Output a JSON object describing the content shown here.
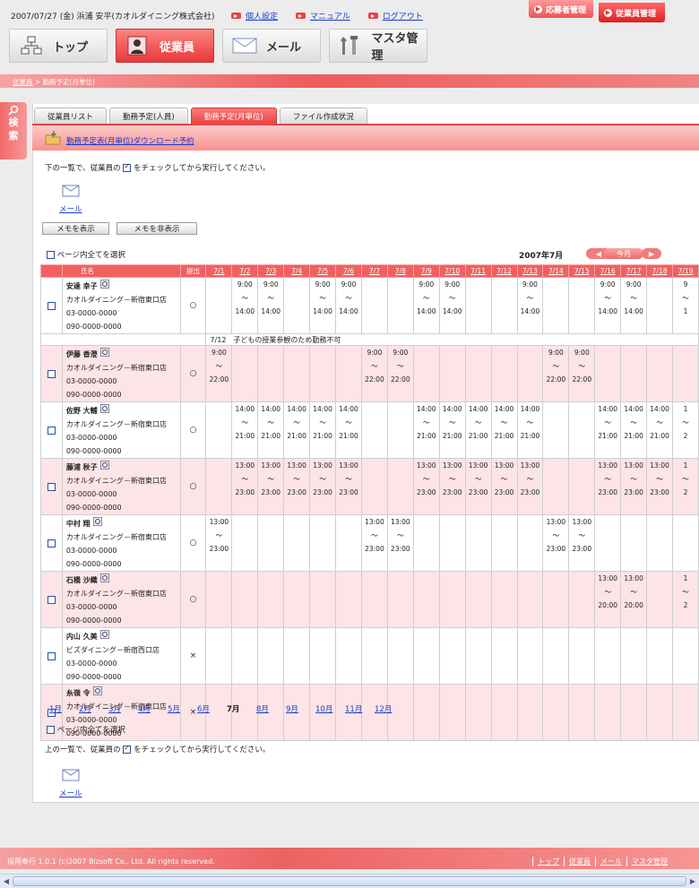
{
  "header": {
    "info": "2007/07/27 (金) 浜浦  安平(カオルダイニング株式会社)",
    "links": [
      "個人設定",
      "マニュアル",
      "ログアウト"
    ],
    "right_tabs": [
      "応募者管理",
      "従業員管理"
    ]
  },
  "nav": [
    "トップ",
    "従業員",
    "メール",
    "マスタ管理"
  ],
  "breadcrumb": {
    "link": "従業員",
    "sep": " > ",
    "current": "勤務予定(月単位)"
  },
  "search_tab": [
    "検",
    "索"
  ],
  "tabs": [
    "従業員リスト",
    "勤務予定(人員)",
    "勤務予定(月単位)",
    "ファイル作成状況"
  ],
  "download_link": "勤務予定表(月単位)ダウンロード予約",
  "instruction_top": {
    "before": "下の一覧で、従業員の",
    "after": "をチェックしてから実行してください。"
  },
  "instruction_bottom": {
    "before": "上の一覧で、従業員の",
    "after": "をチェックしてから実行してください。"
  },
  "mail_label": "メール",
  "memo_show": "メモを表示",
  "memo_hide": "メモを非表示",
  "select_all": "ページ内全てを選択",
  "month_title": "2007年7月",
  "month_nav": {
    "prev": "◀",
    "today": "今月",
    "next": "▶"
  },
  "table": {
    "head_name": "氏名",
    "head_submit": "提出",
    "dates": [
      "7/1",
      "7/2",
      "7/3",
      "7/4",
      "7/5",
      "7/6",
      "7/7",
      "7/8",
      "7/9",
      "7/10",
      "7/11",
      "7/12",
      "7/13",
      "7/14",
      "7/15",
      "7/16",
      "7/17",
      "7/18",
      "7/19"
    ],
    "tilde": "～",
    "rows": [
      {
        "name": "安達 幸子",
        "store": "カオルダイニング－新宿東口店",
        "tel": "03-0000-0000",
        "mobile": "090-0000-0000",
        "submitted": "○",
        "shifts": [
          null,
          [
            "9:00",
            "14:00"
          ],
          [
            "9:00",
            "14:00"
          ],
          null,
          [
            "9:00",
            "14:00"
          ],
          [
            "9:00",
            "14:00"
          ],
          null,
          null,
          [
            "9:00",
            "14:00"
          ],
          [
            "9:00",
            "14:00"
          ],
          null,
          null,
          [
            "9:00",
            "14:00"
          ],
          null,
          null,
          [
            "9:00",
            "14:00"
          ],
          [
            "9:00",
            "14:00"
          ],
          null,
          [
            "9",
            "1"
          ]
        ],
        "memo": "7/12　子どもの授業参観のため勤務不可"
      },
      {
        "name": "伊藤 香澄",
        "store": "カオルダイニング－新宿東口店",
        "tel": "03-0000-0000",
        "mobile": "090-0000-0000",
        "submitted": "○",
        "shifts": [
          [
            "9:00",
            "22:00"
          ],
          null,
          null,
          null,
          null,
          null,
          [
            "9:00",
            "22:00"
          ],
          [
            "9:00",
            "22:00"
          ],
          null,
          null,
          null,
          null,
          null,
          [
            "9:00",
            "22:00"
          ],
          [
            "9:00",
            "22:00"
          ],
          null,
          null,
          null,
          null
        ]
      },
      {
        "name": "佐野 大輔",
        "store": "カオルダイニング－新宿東口店",
        "tel": "03-0000-0000",
        "mobile": "090-0000-0000",
        "submitted": "○",
        "shifts": [
          null,
          [
            "14:00",
            "21:00"
          ],
          [
            "14:00",
            "21:00"
          ],
          [
            "14:00",
            "21:00"
          ],
          [
            "14:00",
            "21:00"
          ],
          [
            "14:00",
            "21:00"
          ],
          null,
          null,
          [
            "14:00",
            "21:00"
          ],
          [
            "14:00",
            "21:00"
          ],
          [
            "14:00",
            "21:00"
          ],
          [
            "14:00",
            "21:00"
          ],
          [
            "14:00",
            "21:00"
          ],
          null,
          null,
          [
            "14:00",
            "21:00"
          ],
          [
            "14:00",
            "21:00"
          ],
          [
            "14:00",
            "21:00"
          ],
          [
            "1",
            "2"
          ]
        ]
      },
      {
        "name": "藤浦 秋子",
        "store": "カオルダイニング－新宿東口店",
        "tel": "03-0000-0000",
        "mobile": "090-0000-0000",
        "submitted": "○",
        "shifts": [
          null,
          [
            "13:00",
            "23:00"
          ],
          [
            "13:00",
            "23:00"
          ],
          [
            "13:00",
            "23:00"
          ],
          [
            "13:00",
            "23:00"
          ],
          [
            "13:00",
            "23:00"
          ],
          null,
          null,
          [
            "13:00",
            "23:00"
          ],
          [
            "13:00",
            "23:00"
          ],
          [
            "13:00",
            "23:00"
          ],
          [
            "13:00",
            "23:00"
          ],
          [
            "13:00",
            "23:00"
          ],
          null,
          null,
          [
            "13:00",
            "23:00"
          ],
          [
            "13:00",
            "23:00"
          ],
          [
            "13:00",
            "23:00"
          ],
          [
            "1",
            "2"
          ]
        ]
      },
      {
        "name": "中村 翔",
        "store": "カオルダイニング－新宿東口店",
        "tel": "03-0000-0000",
        "mobile": "090-0000-0000",
        "submitted": "○",
        "shifts": [
          [
            "13:00",
            "23:00"
          ],
          null,
          null,
          null,
          null,
          null,
          [
            "13:00",
            "23:00"
          ],
          [
            "13:00",
            "23:00"
          ],
          null,
          null,
          null,
          null,
          null,
          [
            "13:00",
            "23:00"
          ],
          [
            "13:00",
            "23:00"
          ],
          null,
          null,
          null,
          null
        ]
      },
      {
        "name": "石橋 沙織",
        "store": "カオルダイニング－新宿東口店",
        "tel": "03-0000-0000",
        "mobile": "090-0000-0000",
        "submitted": "○",
        "shifts": [
          null,
          null,
          null,
          null,
          null,
          null,
          null,
          null,
          null,
          null,
          null,
          null,
          null,
          null,
          null,
          [
            "13:00",
            "20:00"
          ],
          [
            "13:00",
            "20:00"
          ],
          null,
          [
            "1",
            "2"
          ]
        ]
      },
      {
        "name": "内山 久美",
        "store": "ビズダイニング－新宿西口店",
        "tel": "03-0000-0000",
        "mobile": "090-0000-0000",
        "submitted": "×",
        "shifts": [
          null,
          null,
          null,
          null,
          null,
          null,
          null,
          null,
          null,
          null,
          null,
          null,
          null,
          null,
          null,
          null,
          null,
          null,
          null
        ]
      },
      {
        "name": "糸嶺 令",
        "store": "カオルダイニング－新宿東口店",
        "tel": "03-0000-0000",
        "mobile": "090-0000-0000",
        "submitted": "×",
        "shifts": [
          null,
          null,
          null,
          null,
          null,
          null,
          null,
          null,
          null,
          null,
          null,
          null,
          null,
          null,
          null,
          null,
          null,
          null,
          null
        ]
      }
    ]
  },
  "months": [
    "1月",
    "2月",
    "3月",
    "4月",
    "5月",
    "6月",
    "7月",
    "8月",
    "9月",
    "10月",
    "11月",
    "12月"
  ],
  "current_month": "7月",
  "footer": {
    "copyright": "採用奉行 1.0.1 (c)2007 Bizsoft Co., Ltd. All rights reserved.",
    "links": [
      "トップ",
      "従業員",
      "メール",
      "マスタ管理"
    ]
  },
  "colors": {
    "accent": "#ee4444",
    "link": "#1a3cc8",
    "row_pink": "#fde4e6"
  }
}
